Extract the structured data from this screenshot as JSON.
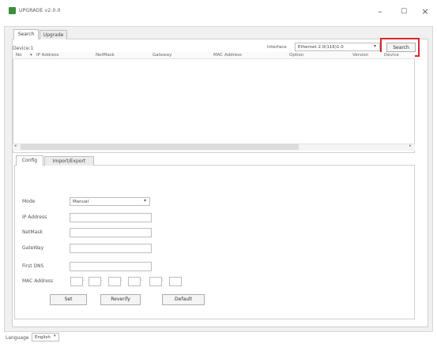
{
  "window": {
    "title": "UPGRADE v2.0.0",
    "minimize": "–",
    "maximize": "☐",
    "close": "×"
  },
  "tabs": [
    {
      "label": "Search",
      "active": true
    },
    {
      "label": "Upgrade",
      "active": false
    }
  ],
  "search": {
    "devices_label": "Device:1",
    "interface_label": "Interface",
    "interface_value": "Ethernet 2.0(116)1.0",
    "button_label": "Search"
  },
  "device_table": {
    "columns": [
      "No",
      "IP Address",
      "NetMask",
      "Gateway",
      "MAC Address",
      "Option",
      "Version",
      "Device"
    ],
    "rows": []
  },
  "config_tabs": [
    {
      "label": "Config",
      "active": true
    },
    {
      "label": "Import/Export",
      "active": false
    }
  ],
  "config": {
    "mode_label": "Mode",
    "mode_value": "Manual",
    "ip_label": "IP Address",
    "ip_value": "",
    "netmask_label": "NetMask",
    "netmask_value": "",
    "gateway_label": "GateWay",
    "gateway_value": "",
    "dns_label": "First DNS",
    "dns_value": "",
    "mac_label": "MAC Address",
    "mac_separator": ":"
  },
  "buttons": {
    "set": "Set",
    "reverify": "Reverify",
    "default": "Default"
  },
  "footer": {
    "language_label": "Language",
    "language_value": "English"
  },
  "colors": {
    "highlight": "#d7262d",
    "app_icon": "#3a8f3a"
  }
}
